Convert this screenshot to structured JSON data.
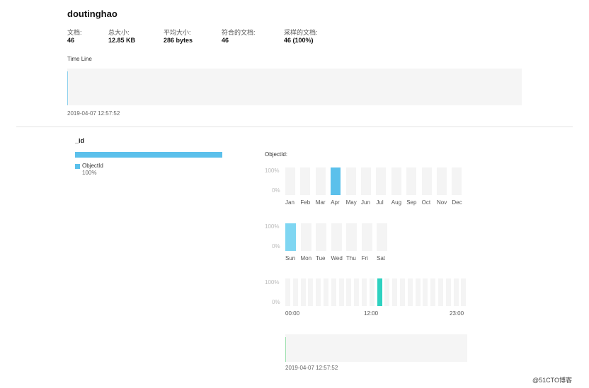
{
  "collection_title": "doutinghao",
  "stats": [
    {
      "label": "文档:",
      "value": "46"
    },
    {
      "label": "总大小:",
      "value": "12.85 KB"
    },
    {
      "label": "平均大小:",
      "value": "286 bytes"
    },
    {
      "label": "符合的文档:",
      "value": "46"
    },
    {
      "label": "采样的文档:",
      "value": "46 (100%)"
    }
  ],
  "timeline": {
    "label": "Time Line",
    "timestamp": "2019-04-07 12:57:52"
  },
  "field": {
    "name": "_id",
    "type_share": 1.0,
    "legend_label": "ObjectId",
    "legend_pct": "100%"
  },
  "objectid_panel": {
    "label": "ObjectId:",
    "pct_top": "100%",
    "pct_bottom": "0%",
    "months": [
      "Jan",
      "Feb",
      "Mar",
      "Apr",
      "May",
      "Jun",
      "Jul",
      "Aug",
      "Sep",
      "Oct",
      "Nov",
      "Dec"
    ],
    "month_values": [
      0,
      0,
      0,
      1,
      0,
      0,
      0,
      0,
      0,
      0,
      0,
      0
    ],
    "weekdays": [
      "Sun",
      "Mon",
      "Tue",
      "Wed",
      "Thu",
      "Fri",
      "Sat"
    ],
    "weekday_values": [
      1,
      0,
      0,
      0,
      0,
      0,
      0
    ],
    "hour_labels": [
      "00:00",
      "12:00",
      "23:00"
    ],
    "hour_values": [
      0,
      0,
      0,
      0,
      0,
      0,
      0,
      0,
      0,
      0,
      0,
      0,
      1,
      0,
      0,
      0,
      0,
      0,
      0,
      0,
      0,
      0,
      0,
      0
    ],
    "timestamp": "2019-04-07 12:57:52"
  },
  "colors": {
    "month_bar": "#5bc0eb",
    "weekday_bar": "#7fd6f2",
    "hour_bar": "#2ed1c0",
    "type_bar": "#5bc0eb"
  },
  "watermark": "@51CTO博客"
}
